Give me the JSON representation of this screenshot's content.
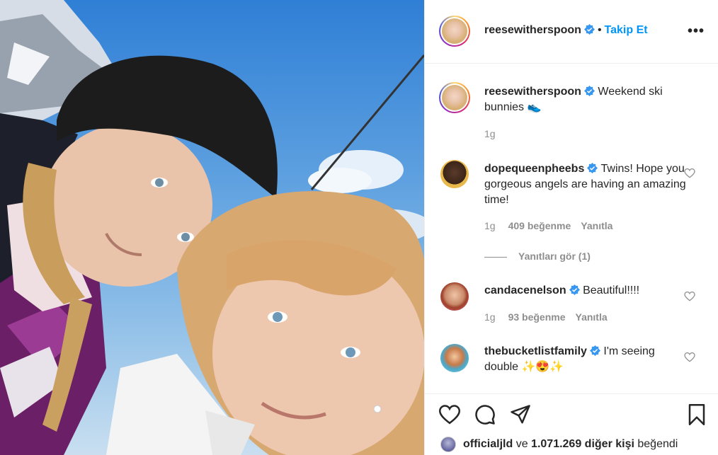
{
  "post": {
    "username": "reesewitherspoon",
    "follow_label": "Takip Et",
    "more_label": "•••"
  },
  "caption": {
    "username": "reesewitherspoon",
    "text": "Weekend ski bunnies",
    "emoji": "👟",
    "time": "1g"
  },
  "comments": [
    {
      "username": "dopequeenpheebs",
      "text": "Twins! Hope you gorgeous angels are having an amazing time!",
      "time": "1g",
      "likes": "409 beğenme",
      "reply": "Yanıtla",
      "avatar_color": "#e8b84a"
    },
    {
      "username": "candacenelson",
      "text": "Beautiful!!!!",
      "time": "1g",
      "likes": "93 beğenme",
      "reply": "Yanıtla",
      "avatar_color": "#d86a7a"
    },
    {
      "username": "thebucketlistfamily",
      "text": "I'm seeing double",
      "emoji": "✨😍✨",
      "avatar_color": "#4aa8c9"
    }
  ],
  "view_replies": "Yanıtları gör (1)",
  "likes_line": {
    "user": "officialjld",
    "connector": "ve",
    "count": "1.071.269 diğer kişi",
    "suffix": "beğendi"
  },
  "icons": [
    "heart-icon",
    "comment-icon",
    "share-icon",
    "bookmark-icon",
    "verified-icon"
  ],
  "colors": {
    "accent": "#0095f6",
    "text": "#262626",
    "muted": "#8e8e8e"
  }
}
